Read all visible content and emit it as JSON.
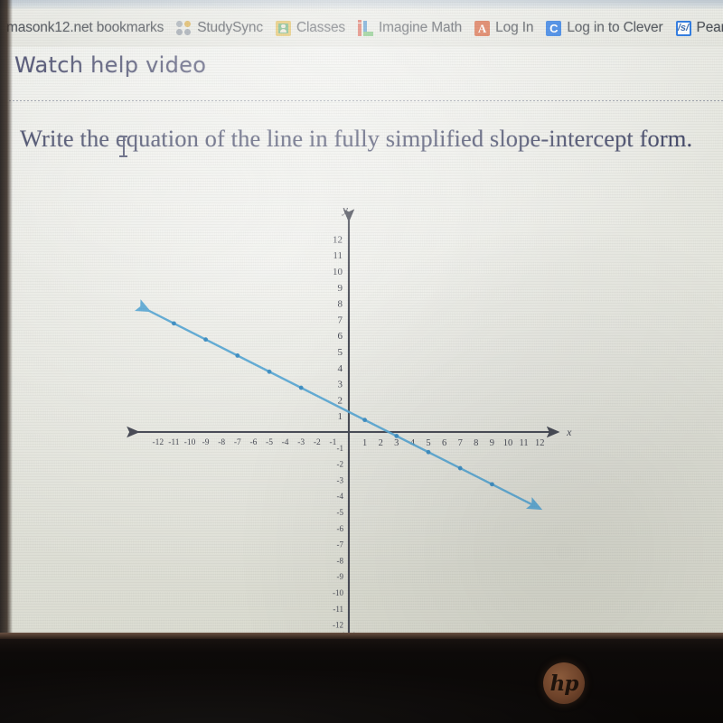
{
  "browser": {
    "bookmarks_bar_label": "masonk12.net bookmarks",
    "bookmarks": [
      {
        "label": "StudySync",
        "icon": "studysync-dots-icon"
      },
      {
        "label": "Classes",
        "icon": "google-classroom-icon"
      },
      {
        "label": "Imagine Math",
        "icon": "imagine-math-icon"
      },
      {
        "label": "Log In",
        "icon": "achieve3000-a-icon"
      },
      {
        "label": "Log in to Clever",
        "icon": "clever-c-icon"
      },
      {
        "label": "Pearson",
        "icon": "pearson-s-icon"
      }
    ]
  },
  "page": {
    "help_link": "Watch help video",
    "question": "Write the equation of the line in fully simplified slope-intercept form."
  },
  "chart_data": {
    "type": "line",
    "title": "",
    "xlabel": "x",
    "ylabel": "y",
    "xlim": [
      -13,
      13
    ],
    "ylim": [
      -13,
      13
    ],
    "xticks": [
      -12,
      -11,
      -10,
      -9,
      -8,
      -7,
      -6,
      -5,
      -4,
      -3,
      -2,
      -1,
      1,
      2,
      3,
      4,
      5,
      6,
      7,
      8,
      9,
      10,
      11,
      12
    ],
    "yticks": [
      12,
      11,
      10,
      9,
      8,
      7,
      6,
      5,
      4,
      3,
      2,
      1,
      -1,
      -2,
      -3,
      -4,
      -5,
      -6,
      -7,
      -8,
      -9,
      -10,
      -11,
      -12
    ],
    "grid": false,
    "axis_color": "#4a4d58",
    "line_color": "#5aa9d6",
    "series": [
      {
        "name": "line",
        "slope": -0.5,
        "intercept": 1.25,
        "equation": "y = -1/2x + 5/4",
        "points": [
          {
            "x": -11,
            "y": 6.75
          },
          {
            "x": -9,
            "y": 5.75
          },
          {
            "x": -7,
            "y": 4.75
          },
          {
            "x": -5,
            "y": 3.75
          },
          {
            "x": -3,
            "y": 2.75
          },
          {
            "x": 1,
            "y": 0.75
          },
          {
            "x": 3,
            "y": -0.25
          },
          {
            "x": 5,
            "y": -1.25
          },
          {
            "x": 7,
            "y": -2.25
          },
          {
            "x": 9,
            "y": -3.25
          }
        ],
        "x_endpoints": [
          -12.6,
          12.0
        ],
        "arrow_both_ends": true
      }
    ]
  },
  "device": {
    "brand_logo": "hp"
  }
}
